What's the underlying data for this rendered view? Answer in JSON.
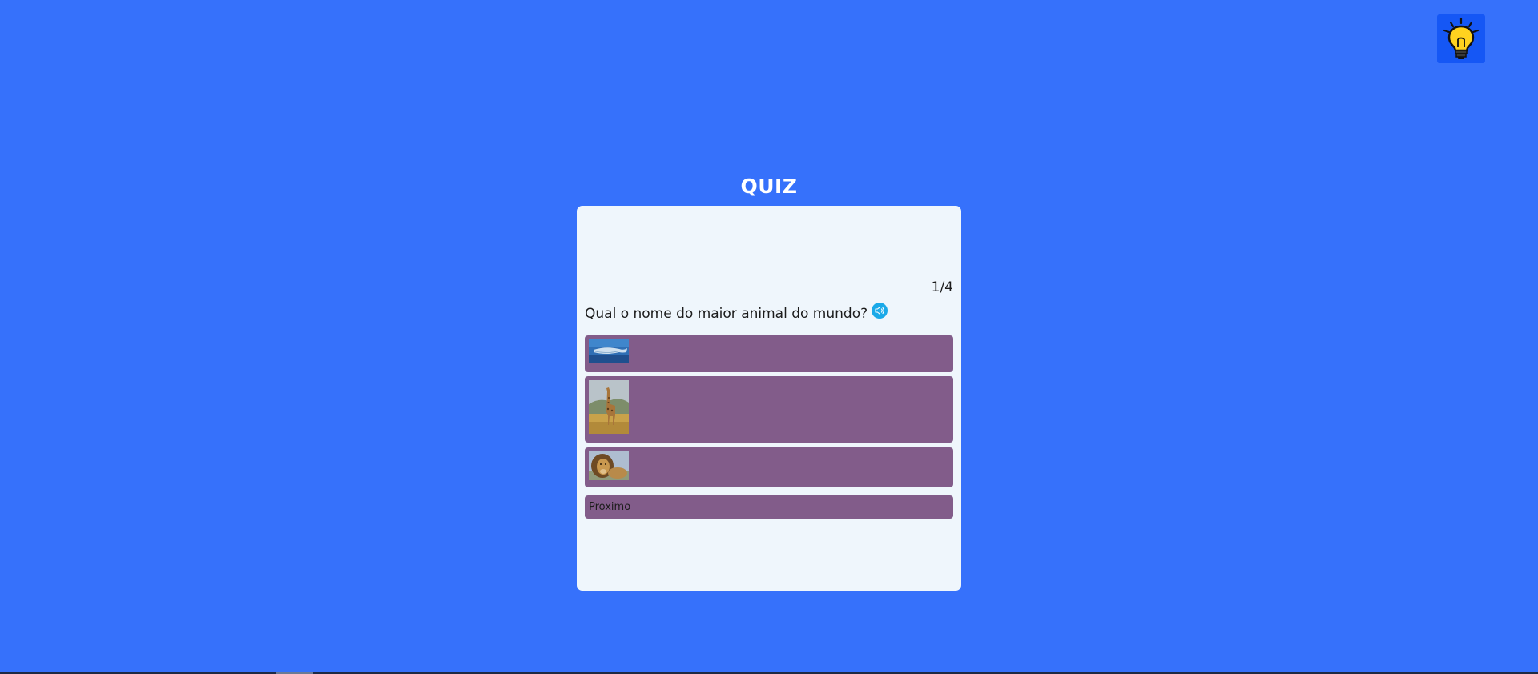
{
  "header": {
    "title": "QUIZ",
    "hint_icon": "lightbulb-icon"
  },
  "quiz": {
    "counter": "1/4",
    "question": "Qual o nome do maior animal do mundo?",
    "audio_icon": "speaker-icon",
    "options": [
      {
        "image": "whale-image"
      },
      {
        "image": "giraffe-image"
      },
      {
        "image": "lion-image"
      }
    ],
    "next_label": "Proximo"
  },
  "colors": {
    "background": "#3671fb",
    "card": "#eff6fc",
    "option": "#825c8a",
    "hint_button": "#1557f5",
    "audio_button": "#1aa9e8"
  }
}
